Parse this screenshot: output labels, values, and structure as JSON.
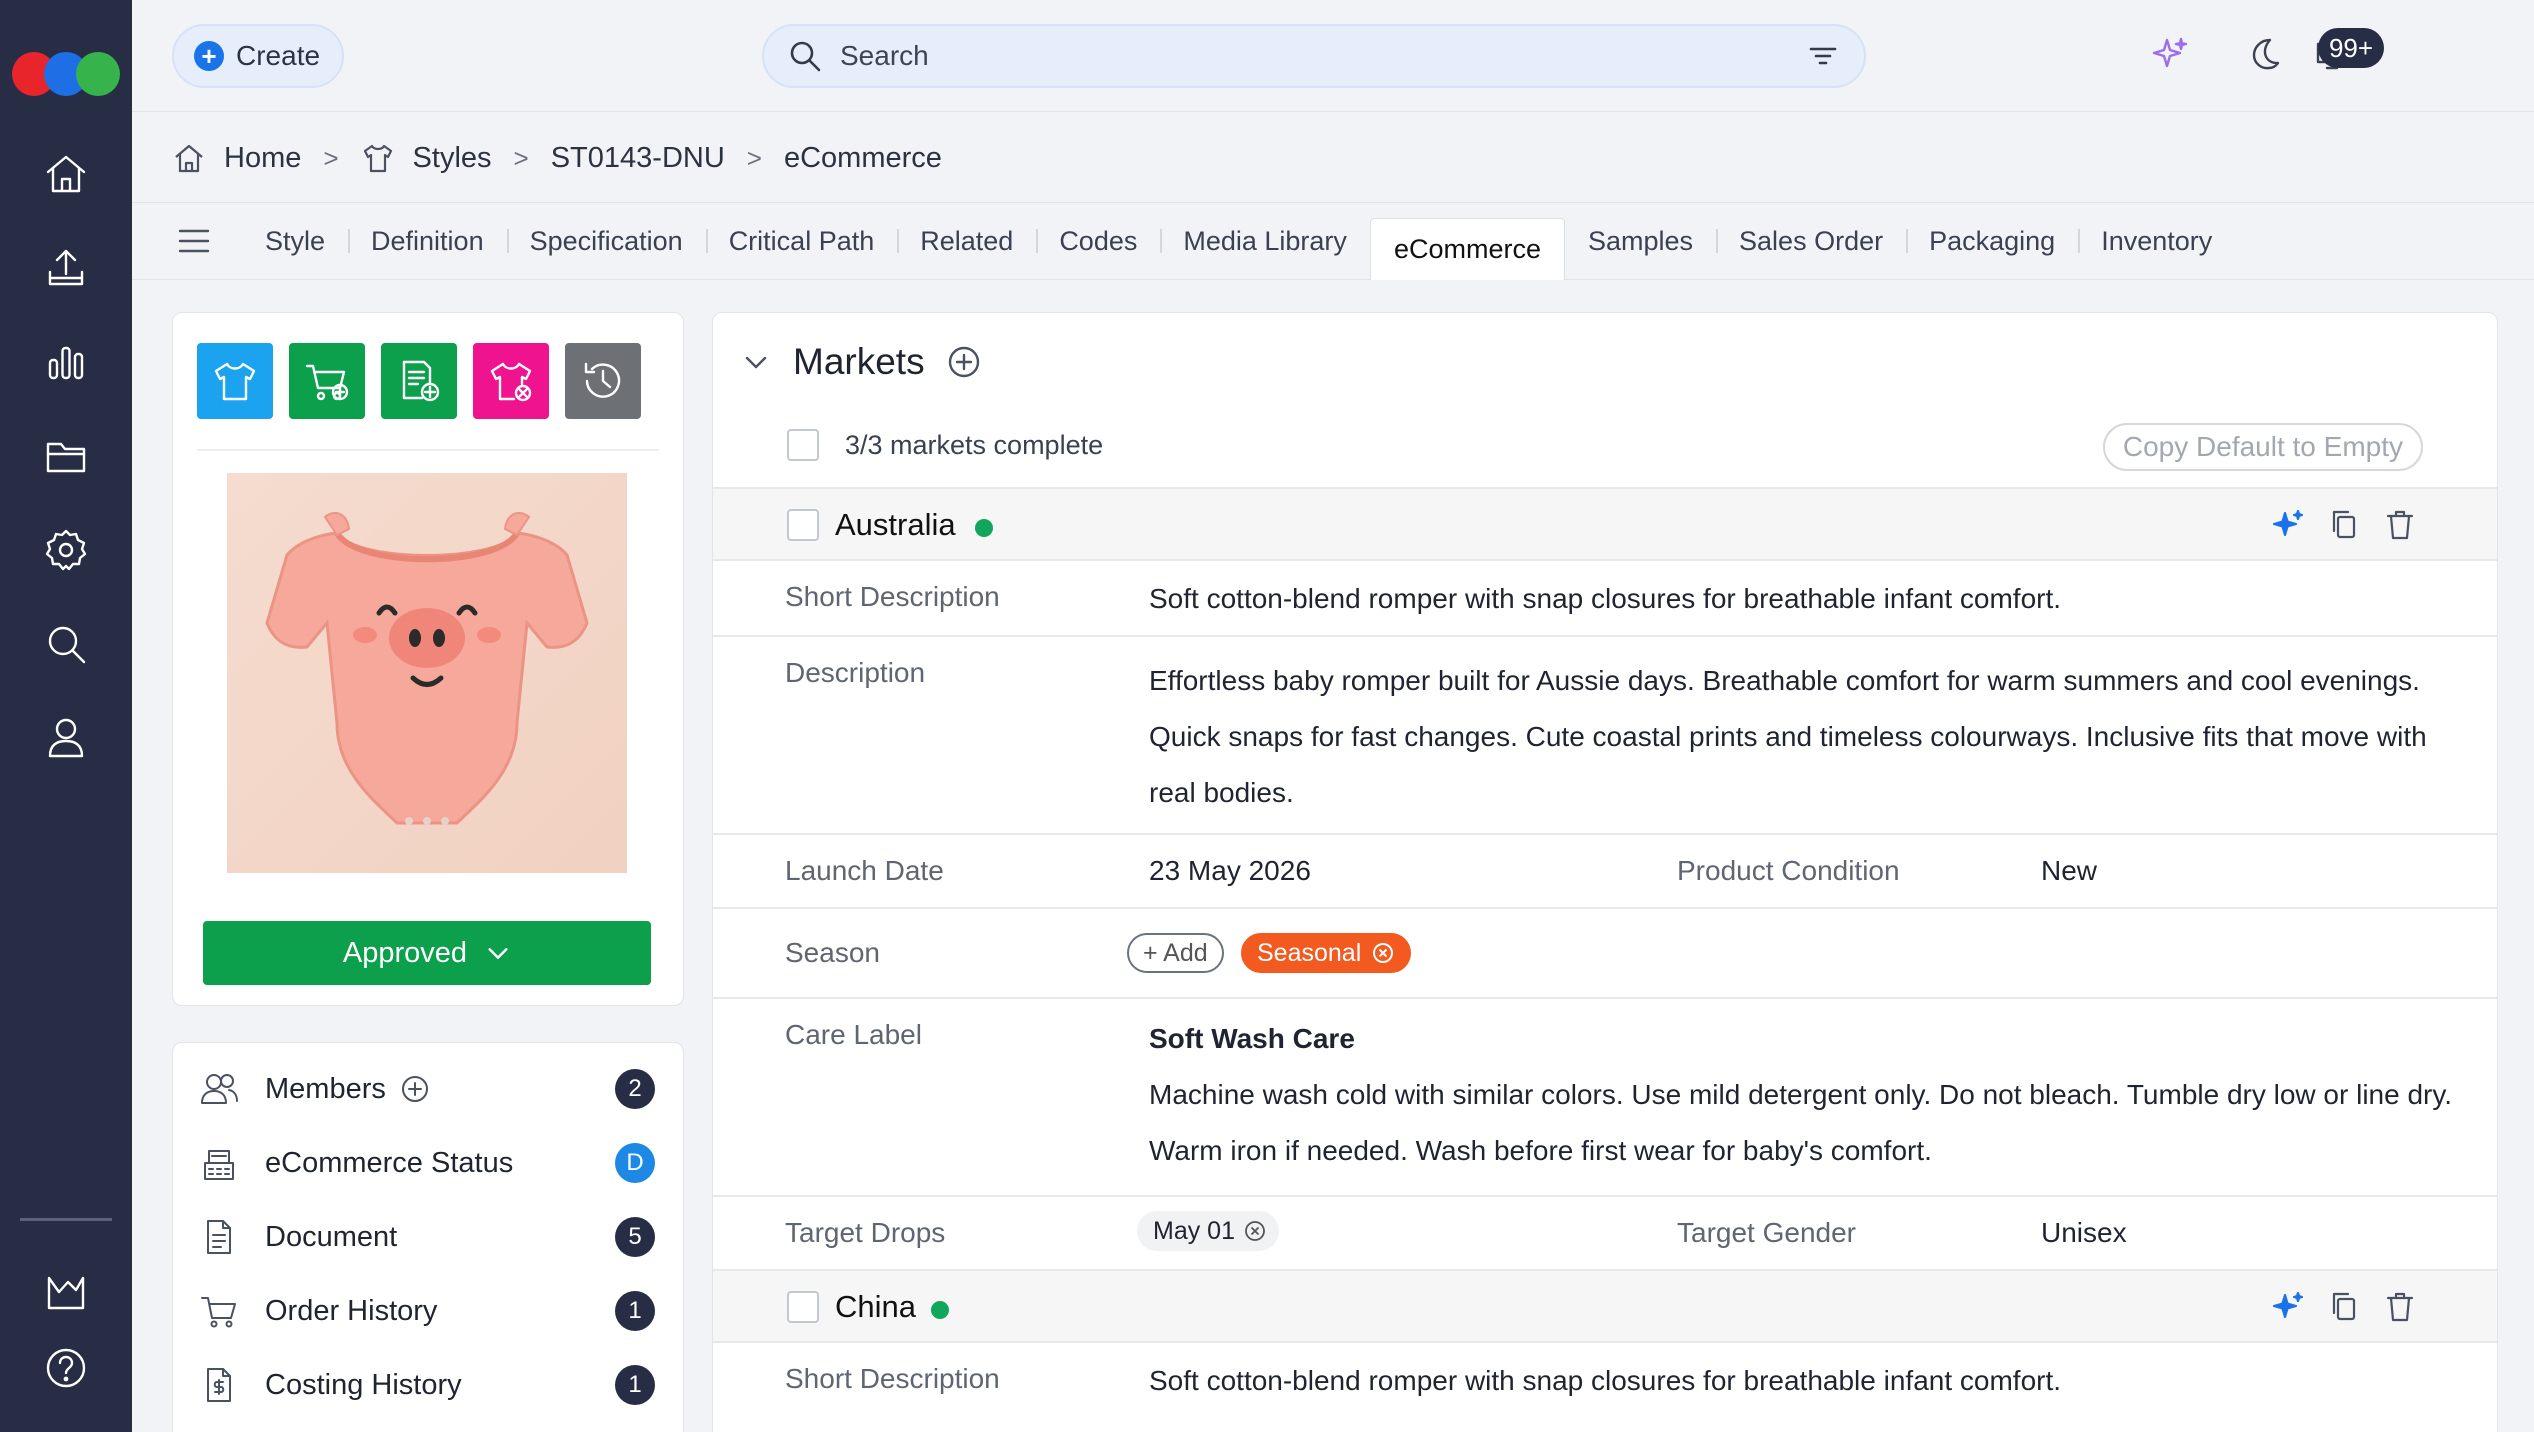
{
  "topbar": {
    "create_label": "Create",
    "search_placeholder": "Search",
    "notifications_count": "99+"
  },
  "breadcrumb": [
    "Home",
    "Styles",
    "ST0143-DNU",
    "eCommerce"
  ],
  "tabs": [
    "Style",
    "Definition",
    "Specification",
    "Critical Path",
    "Related",
    "Codes",
    "Media Library",
    "eCommerce",
    "Samples",
    "Sales Order",
    "Packaging",
    "Inventory"
  ],
  "active_tab": "eCommerce",
  "product": {
    "status_label": "Approved",
    "tile_colors": [
      "#1ba3ef",
      "#0c9f4c",
      "#0c9f4c",
      "#f0138f",
      "#6d7075"
    ]
  },
  "links": [
    {
      "label": "Members",
      "count": "2"
    },
    {
      "label": "eCommerce Status",
      "count": "D"
    },
    {
      "label": "Document",
      "count": "5"
    },
    {
      "label": "Order History",
      "count": "1"
    },
    {
      "label": "Costing History",
      "count": "1"
    }
  ],
  "markets": {
    "title": "Markets",
    "complete_text": "3/3 markets complete",
    "copy_default_label": "Copy Default to Empty",
    "australia": {
      "name": "Australia",
      "short_description_label": "Short Description",
      "short_description": "Soft cotton-blend romper with snap closures for breathable infant comfort.",
      "description_label": "Description",
      "description": "Effortless baby romper built for Aussie days. Breathable comfort for warm summers and cool evenings. Quick snaps for fast changes. Cute coastal prints and timeless colourways. Inclusive fits that move with real bodies.",
      "launch_date_label": "Launch Date",
      "launch_date": "23 May 2026",
      "product_condition_label": "Product Condition",
      "product_condition": "New",
      "season_label": "Season",
      "add_label": "+ Add",
      "season_chip": "Seasonal",
      "care_label_label": "Care Label",
      "care_title": "Soft Wash Care",
      "care_text": "Machine wash cold with similar colors. Use mild detergent only. Do not bleach. Tumble dry low or line dry. Warm iron if needed. Wash before first wear for baby's comfort.",
      "target_drops_label": "Target Drops",
      "target_drop_chip": "May 01",
      "target_gender_label": "Target Gender",
      "target_gender": "Unisex"
    },
    "china": {
      "name": "China",
      "short_description_label": "Short Description",
      "short_description": "Soft cotton-blend romper with snap closures for breathable infant comfort."
    }
  }
}
